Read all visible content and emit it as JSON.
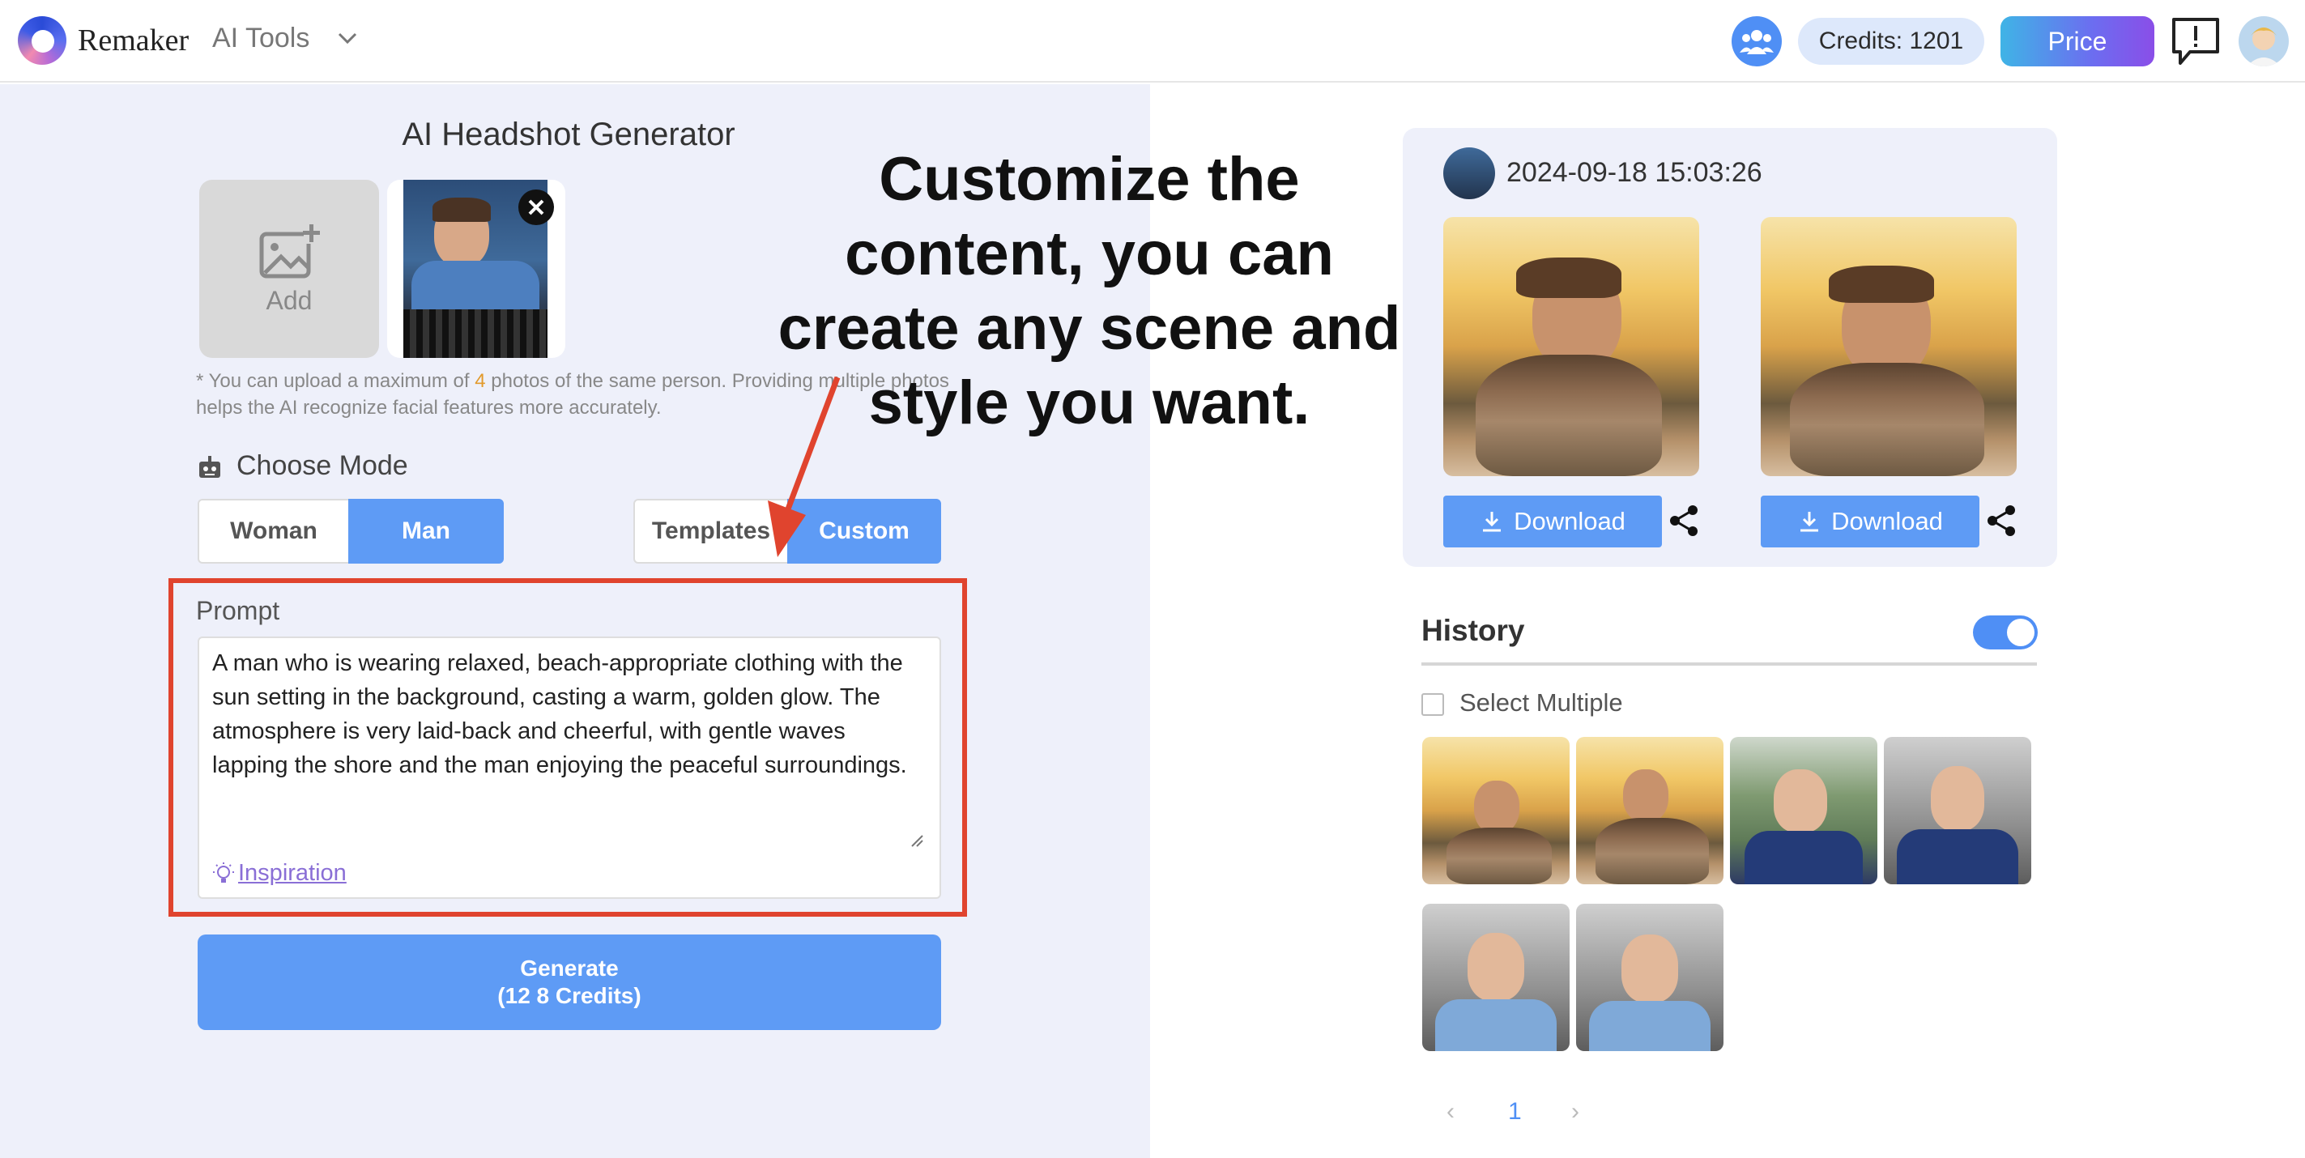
{
  "header": {
    "brand": "Remaker",
    "menu_label": "AI Tools",
    "credits": "Credits: 1201",
    "price_label": "Price"
  },
  "generator": {
    "title": "AI Headshot Generator",
    "add_label": "Add",
    "note_prefix": "* You can upload a maximum of ",
    "note_count": "4",
    "note_suffix": " photos of the same person. Providing multiple photos helps the AI recognize facial features more accurately.",
    "mode_title": "Choose Mode",
    "gender_options": [
      "Woman",
      "Man"
    ],
    "selected_gender": "Man",
    "style_options": [
      "Templates",
      "Custom"
    ],
    "selected_style": "Custom",
    "prompt_label": "Prompt",
    "prompt_text": "A man who is wearing relaxed, beach-appropriate clothing with the sun setting in the background, casting a warm, golden glow. The atmosphere is very laid-back and cheerful, with gentle waves lapping the shore and the man enjoying the peaceful surroundings.",
    "inspiration_label": "Inspiration",
    "generate_label": "Generate",
    "generate_credits": "(12 8 Credits)"
  },
  "overlay_text": "Customize the content, you can create any scene and style you want.",
  "result": {
    "timestamp": "2024-09-18 15:03:26",
    "download_label": "Download"
  },
  "history": {
    "title": "History",
    "select_multiple": "Select Multiple",
    "current_page": "1",
    "prev": "‹",
    "next": "›"
  },
  "colors": {
    "accent": "#5e9bf5",
    "highlight_box": "#e0442e",
    "note_highlight": "#e29a2c",
    "panel_bg": "#eef0fa"
  }
}
